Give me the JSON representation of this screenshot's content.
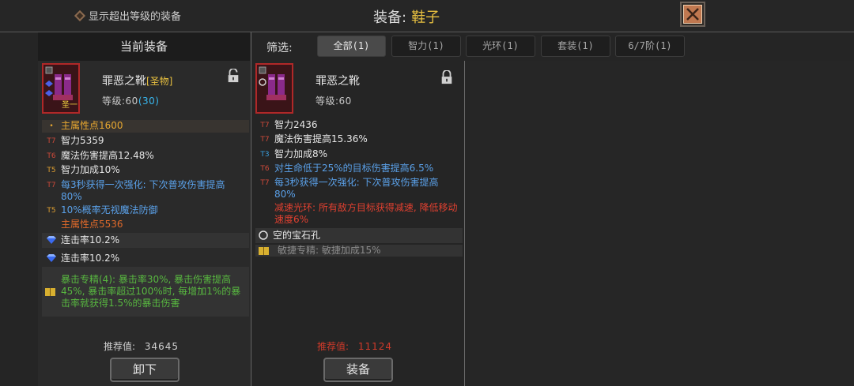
{
  "topbar": {
    "show_over_level": "显示超出等级的装备",
    "title_label": "装备:",
    "title_value": "鞋子"
  },
  "left": {
    "header": "当前装备",
    "item": {
      "name": "罪恶之靴",
      "tag": "[圣物]",
      "level_label": "等级:60",
      "level_extra": "(30)",
      "badge": "圣一"
    },
    "stats": [
      {
        "tier": "•",
        "text": "主属性点1600"
      },
      {
        "tier": "T7",
        "text": "智力5359"
      },
      {
        "tier": "T6",
        "text": "魔法伤害提高12.48%"
      },
      {
        "tier": "T5",
        "text": "智力加成10%"
      },
      {
        "tier": "T7",
        "text": "每3秒获得一次强化: 下次普攻伤害提高80%"
      },
      {
        "tier": "T5",
        "text": "10%概率无视魔法防御"
      },
      {
        "tier": "",
        "text": "主属性点5536"
      }
    ],
    "gems": [
      "连击率10.2%",
      "连击率10.2%"
    ],
    "set_text": "暴击专精(4): 暴击率30%, 暴击伤害提高45%, 暴击率超过100%时, 每增加1%的暴击率就获得1.5%的暴击伤害",
    "score_label": "推荐值:",
    "score_value": "34645",
    "button": "卸下"
  },
  "filter": {
    "label": "筛选:",
    "tabs": [
      "全部(1)",
      "智力(1)",
      "光环(1)",
      "套装(1)",
      "6/7阶(1)"
    ]
  },
  "right": {
    "item": {
      "name": "罪恶之靴",
      "level_label": "等级:60"
    },
    "stats": [
      {
        "tier": "T7",
        "text": "智力2436"
      },
      {
        "tier": "T7",
        "text": "魔法伤害提高15.36%"
      },
      {
        "tier": "T3",
        "text": "智力加成8%"
      },
      {
        "tier": "T6",
        "text": "对生命低于25%的目标伤害提高6.5%"
      },
      {
        "tier": "T7",
        "text": "每3秒获得一次强化: 下次普攻伤害提高80%"
      }
    ],
    "aura_text": "减速光环: 所有敌方目标获得减速, 降低移动速度6%",
    "socket_text": "空的宝石孔",
    "set_text": "敏捷专精: 敏捷加成15%",
    "score_label": "推荐值:",
    "score_value": "11124",
    "button": "装备"
  },
  "colors": {
    "accent_gold": "#e8c040",
    "tier_red": "#d04a3a",
    "tier_gold": "#e0a030",
    "tier_blue": "#38a0e0",
    "set_green": "#58b840",
    "aura_red": "#e04030"
  }
}
